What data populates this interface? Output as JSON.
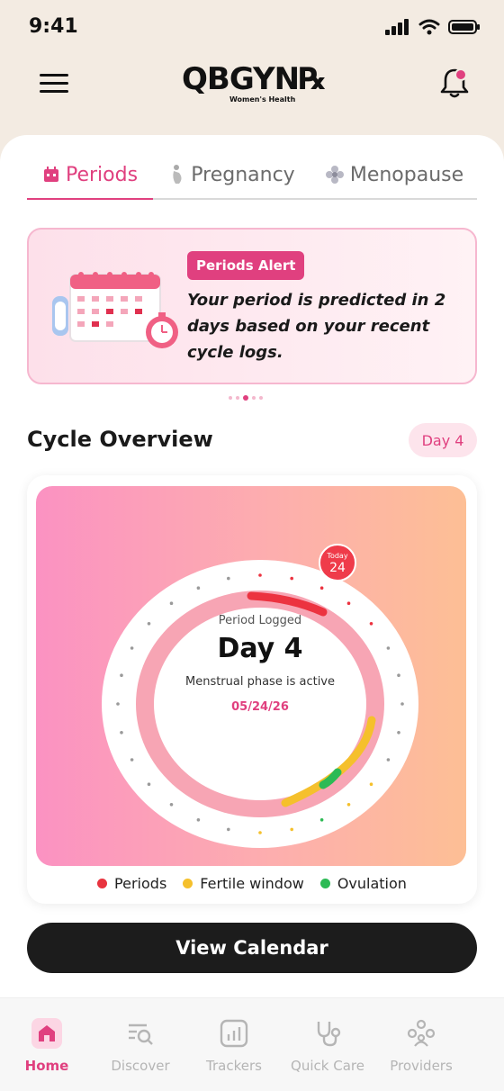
{
  "status_bar": {
    "time": "9:41"
  },
  "header": {
    "logo_text": "QBGYN℞",
    "logo_subtitle": "Women's Health"
  },
  "tabs": [
    {
      "label": "Periods",
      "active": true
    },
    {
      "label": "Pregnancy",
      "active": false
    },
    {
      "label": "Menopause",
      "active": false
    }
  ],
  "alert": {
    "badge": "Periods Alert",
    "message": "Your period is predicted in 2 days based on your recent cycle logs."
  },
  "carousel": {
    "index": 2,
    "count": 5
  },
  "cycle_overview": {
    "title": "Cycle Overview",
    "day_pill": "Day 4",
    "status_label": "Period Logged",
    "day": "Day 4",
    "phase": "Menstrual phase is active",
    "date": "05/24/26",
    "today_label": "Today",
    "today_day": "24",
    "legend": [
      {
        "label": "Periods",
        "color": "#e8343f"
      },
      {
        "label": "Fertile window",
        "color": "#f5c02c"
      },
      {
        "label": "Ovulation",
        "color": "#2dba55"
      }
    ]
  },
  "view_calendar_label": "View Calendar",
  "bottom_nav": [
    {
      "label": "Home",
      "icon": "home-icon",
      "active": true
    },
    {
      "label": "Discover",
      "icon": "discover-icon",
      "active": false
    },
    {
      "label": "Trackers",
      "icon": "trackers-icon",
      "active": false
    },
    {
      "label": "Quick Care",
      "icon": "stethoscope-icon",
      "active": false
    },
    {
      "label": "Providers",
      "icon": "providers-icon",
      "active": false
    }
  ],
  "colors": {
    "brand": "#e0407f",
    "header_bg": "#f3ebe2"
  }
}
